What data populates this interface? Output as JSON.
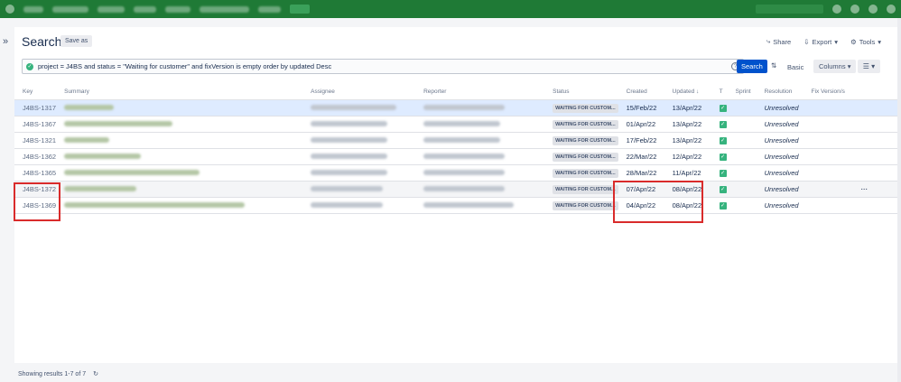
{
  "page": {
    "title": "Search",
    "save_as": "Save as",
    "share": "Share",
    "export": "Export",
    "tools": "Tools"
  },
  "jql": {
    "query": "project = J4BS and status = \"Waiting for customer\" and fixVersion is empty order by updated Desc",
    "search_button": "Search",
    "basic": "Basic",
    "columns": "Columns"
  },
  "columns": [
    "Key",
    "Summary",
    "Assignee",
    "Reporter",
    "Status",
    "Created",
    "Updated",
    "T",
    "Sprint",
    "Resolution",
    "Fix Version/s"
  ],
  "rows": [
    {
      "key": "J4BS-1317",
      "status": "WAITING FOR CUSTOM...",
      "created": "15/Feb/22",
      "updated": "13/Apr/22",
      "resolution": "Unresolved"
    },
    {
      "key": "J4BS-1367",
      "status": "WAITING FOR CUSTOM...",
      "created": "01/Apr/22",
      "updated": "13/Apr/22",
      "resolution": "Unresolved"
    },
    {
      "key": "J4BS-1321",
      "status": "WAITING FOR CUSTOM...",
      "created": "17/Feb/22",
      "updated": "13/Apr/22",
      "resolution": "Unresolved"
    },
    {
      "key": "J4BS-1362",
      "status": "WAITING FOR CUSTOM...",
      "created": "22/Mar/22",
      "updated": "12/Apr/22",
      "resolution": "Unresolved"
    },
    {
      "key": "J4BS-1365",
      "status": "WAITING FOR CUSTOM...",
      "created": "28/Mar/22",
      "updated": "11/Apr/22",
      "resolution": "Unresolved"
    },
    {
      "key": "J4BS-1372",
      "status": "WAITING FOR CUSTOM...",
      "created": "07/Apr/22",
      "updated": "08/Apr/22",
      "resolution": "Unresolved"
    },
    {
      "key": "J4BS-1369",
      "status": "WAITING FOR CUSTOM...",
      "created": "04/Apr/22",
      "updated": "08/Apr/22",
      "resolution": "Unresolved"
    }
  ],
  "footer": {
    "showing": "Showing results 1-7 of 7"
  }
}
